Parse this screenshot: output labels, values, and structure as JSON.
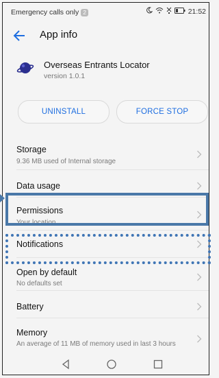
{
  "status_bar": {
    "carrier_text": "Emergency calls only",
    "badge": "2",
    "time": "21:52"
  },
  "app_bar": {
    "title": "App info"
  },
  "app": {
    "name": "Overseas Entrants Locator",
    "version": "version 1.0.1",
    "icon": "planet-app-icon"
  },
  "actions": {
    "uninstall": "UNINSTALL",
    "force_stop": "FORCE STOP"
  },
  "rows": [
    {
      "title": "Storage",
      "subtitle": "9.36 MB used of Internal storage"
    },
    {
      "title": "Data usage",
      "subtitle": ""
    },
    {
      "title": "Permissions",
      "subtitle": "Your location"
    },
    {
      "title": "Notifications",
      "subtitle": ""
    },
    {
      "title": "Open by default",
      "subtitle": "No defaults set"
    },
    {
      "title": "Battery",
      "subtitle": ""
    },
    {
      "title": "Memory",
      "subtitle": "An average of 11 MB of memory used in last 3 hours"
    }
  ],
  "colors": {
    "accent": "#1e6ee0",
    "highlight": "#4a78a8"
  }
}
